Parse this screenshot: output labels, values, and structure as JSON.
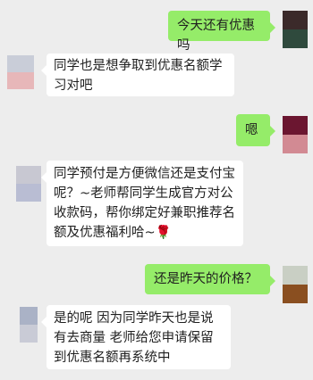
{
  "messages": [
    {
      "side": "right",
      "text": "今天还有优惠吗"
    },
    {
      "side": "left",
      "text": "同学也是想争取到优惠名额学习对吧"
    },
    {
      "side": "right",
      "text": "嗯"
    },
    {
      "side": "left",
      "text": "同学预付是方便微信还是支付宝呢？~老师帮同学生成官方对公收款码，帮你绑定好兼职推荐名额及优惠福利哈~",
      "emoji": "🌹"
    },
    {
      "side": "right",
      "text": "还是昨天的价格？"
    },
    {
      "side": "left",
      "text": "是的呢 因为同学昨天也是说有去商量 老师给您申请保留到优惠名额再系统中"
    }
  ],
  "colors": {
    "self_bubble": "#95ec69",
    "other_bubble": "#ffffff",
    "background": "#ededed"
  },
  "avatars": {
    "self": "blurred-avatar-dark-red",
    "other": "blurred-avatar-light"
  }
}
